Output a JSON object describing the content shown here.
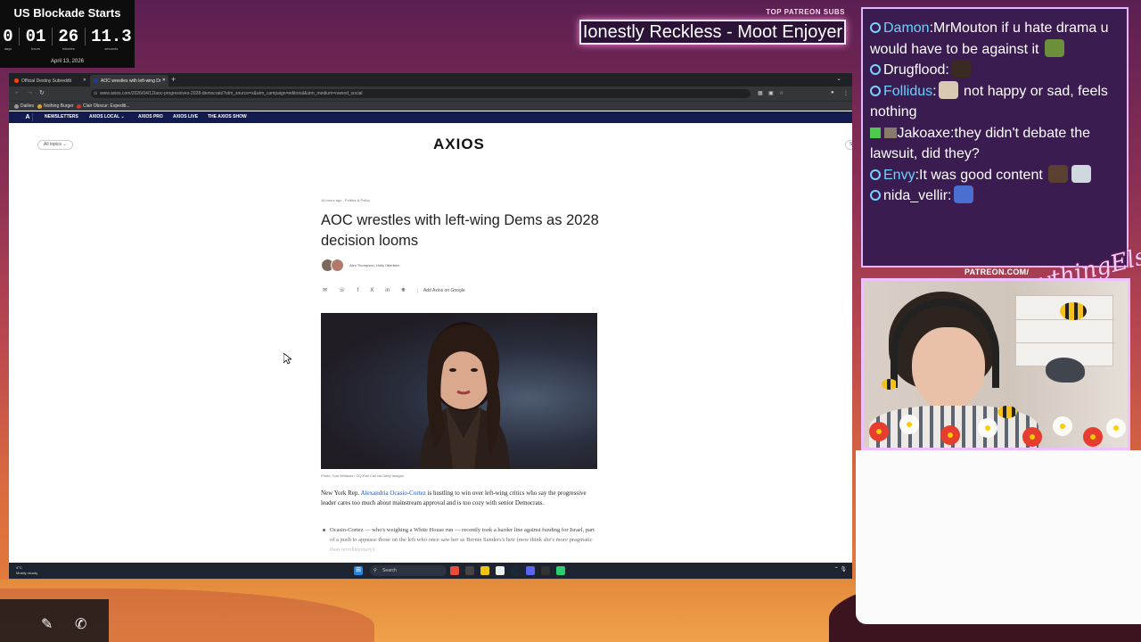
{
  "countdown": {
    "title": "US Blockade Starts",
    "days": "0",
    "days_label": "days",
    "hours": "01",
    "hours_label": "hours",
    "minutes": "26",
    "minutes_label": "minutes",
    "seconds": "11.3",
    "seconds_label": "seconds",
    "date": "April 13, 2026"
  },
  "patreon": {
    "label": "TOP PATREON SUBS",
    "name": "Ionestly Reckless - Moot Enjoyer",
    "url": "PATREON.COM/",
    "script": "AnythingElse"
  },
  "browser": {
    "tabs": [
      {
        "label": "Official Destiny Subreddit",
        "color": "#ff4500"
      },
      {
        "label": "AOC wrestles with left-wing Dr",
        "color": "#1f3b9a"
      }
    ],
    "new_tab": "+",
    "tab_menu": "⌄",
    "url": "www.axios.com/2026/04/12/aoc-progressives-2028-democrats?utm_source=x&utm_campaign=editorial&utm_medium=owned_social",
    "bookmarks": [
      {
        "label": "Dailies",
        "color": "#999999"
      },
      {
        "label": "Nothing Burger",
        "color": "#e0a030"
      },
      {
        "label": "Clair Obscur: Expediti...",
        "color": "#c0392b"
      }
    ]
  },
  "axios_nav": {
    "logo": "A",
    "items": [
      "NEWSLETTERS",
      "AXIOS LOCAL ⌄",
      "AXIOS PRO",
      "AXIOS LIVE",
      "THE AXIOS SHOW"
    ]
  },
  "page": {
    "all_topics": "All topics ⌄",
    "logo": "AXIOS",
    "search": "Sea",
    "meta": "16 hours ago - Politics & Policy",
    "headline": "AOC wrestles with left-wing Dems as 2028 decision looms",
    "authors": "Alex Thompson, Holly Otterbein",
    "share_icons": [
      "✉",
      "☏",
      "f",
      "X",
      "in",
      "❋"
    ],
    "add_google": "Add Axios on Google",
    "photo_credit": "Photo: Tom Williams / CQ-Roll Call via Getty Images",
    "body_prefix": "New York Rep. ",
    "body_link": "Alexandria Ocasio-Cortez",
    "body_suffix": " is hustling to win over left-wing critics who say the progressive leader cares too much about mainstream approval and is too cozy with senior Democrats.",
    "bullet": "Ocasio-Cortez — who's weighing a White House run — recently took a harder line against funding for Israel, part of a push to appease those on the left who once saw her as Bernie Sanders's heir (now think she's more pragmatic than revolutionary)."
  },
  "taskbar": {
    "weather_temp": "4°C",
    "weather_desc": "Mostly cloudy",
    "search": "Search",
    "tray": "⌃  🎙"
  },
  "chat": {
    "messages": [
      {
        "user": "Damon",
        "user_color": "#67d2ff",
        "text": "MrMouton if u hate drama u would have to be against it",
        "emote": true
      },
      {
        "user": "Drugflood",
        "user_color": "#ffffff",
        "text": "",
        "emote": true
      },
      {
        "user": "Follidus",
        "user_color": "#67d2ff",
        "text": " not happy or sad, feels nothing",
        "emote": true
      },
      {
        "user": "Jakoaxe",
        "user_color": "#ffffff",
        "text": "they didn't debate the lawsuit, did they?",
        "emote": false
      },
      {
        "user": "Envy",
        "user_color": "#67d2ff",
        "text": "It was good content ",
        "emote": true
      },
      {
        "user": "nida_vellir",
        "user_color": "#ffffff",
        "text": "",
        "emote": true
      }
    ]
  },
  "bottom_buttons": [
    "✎",
    "✆"
  ]
}
